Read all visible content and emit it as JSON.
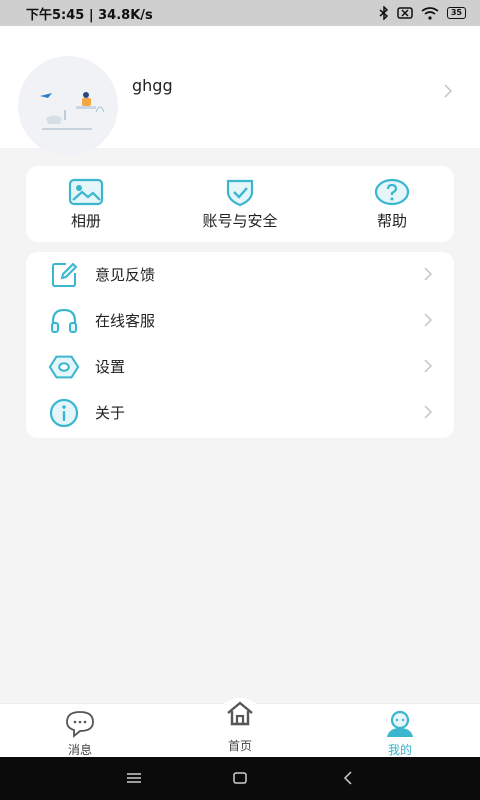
{
  "status_bar": {
    "time_speed": "下午5:45 | 34.8K/s",
    "battery": "35"
  },
  "profile": {
    "username": "ghgg"
  },
  "quick_actions": [
    {
      "label": "相册",
      "icon": "album-icon"
    },
    {
      "label": "账号与安全",
      "icon": "shield-check-icon"
    },
    {
      "label": "帮助",
      "icon": "help-icon"
    }
  ],
  "menu": [
    {
      "label": "意见反馈",
      "icon": "feedback-edit-icon"
    },
    {
      "label": "在线客服",
      "icon": "headset-icon"
    },
    {
      "label": "设置",
      "icon": "settings-hexagon-icon"
    },
    {
      "label": "关于",
      "icon": "info-icon"
    }
  ],
  "tab_bar": {
    "tabs": [
      {
        "label": "消息",
        "icon": "message-bubble-icon"
      },
      {
        "label": "首页",
        "icon": "home-icon"
      },
      {
        "label": "我的",
        "icon": "user-icon",
        "active": true
      }
    ]
  },
  "colors": {
    "accent": "#3ab6cf",
    "page_bg": "#f4f4f4",
    "card_bg": "#ffffff"
  }
}
